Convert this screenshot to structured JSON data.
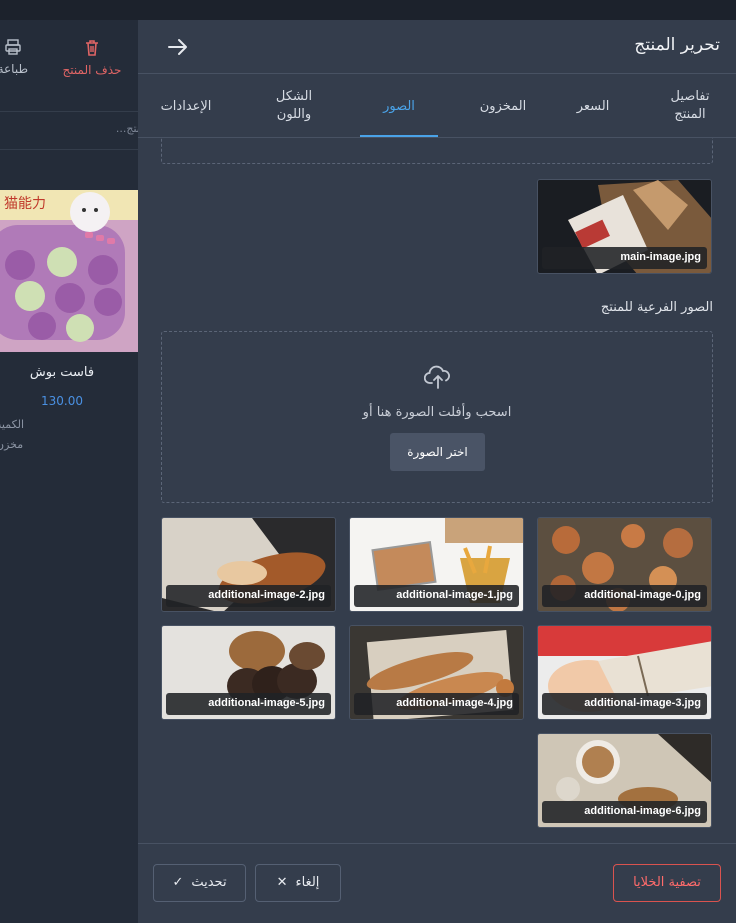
{
  "background_page": {
    "delete_label": "حذف المنتج",
    "print_label": "طباعة",
    "search_placeholder": "منتج...",
    "product_name": "فاست بوش",
    "product_price": "130.00",
    "meta_1": "الكمية",
    "meta_2": "مخزن",
    "card_text": "猫能力"
  },
  "drawer": {
    "title": "تحرير المنتج",
    "tabs": [
      {
        "label": "تفاصيل المنتج",
        "active": false
      },
      {
        "label": "السعر",
        "active": false
      },
      {
        "label": "المخزون",
        "active": false
      },
      {
        "label": "الصور",
        "active": true
      },
      {
        "label": "الشكل واللون",
        "active": false
      },
      {
        "label": "الإعدادات",
        "active": false
      }
    ],
    "main_image": {
      "filename": "main-image.jpg"
    },
    "sub_images_label": "الصور الفرعية للمنتج",
    "dropzone": {
      "text": "اسحب وأفلت الصورة هنا أو",
      "button_label": "اختر الصورة",
      "icon": "upload-cloud-icon"
    },
    "additional_images": [
      {
        "filename": "additional-image-0.jpg",
        "subject": "cookies"
      },
      {
        "filename": "additional-image-1.jpg",
        "subject": "fries-and-tray"
      },
      {
        "filename": "additional-image-2.jpg",
        "subject": "bread-on-newspaper"
      },
      {
        "filename": "additional-image-3.jpg",
        "subject": "wrapped-pastry-in-hand"
      },
      {
        "filename": "additional-image-4.jpg",
        "subject": "baguettes-with-twine"
      },
      {
        "filename": "additional-image-5.jpg",
        "subject": "chocolate-bread-slices"
      },
      {
        "filename": "additional-image-6.jpg",
        "subject": "bowl-and-pretzels"
      }
    ],
    "footer": {
      "clear_label": "تصفية الخلايا",
      "cancel_label": "إلغاء",
      "update_label": "تحديث"
    }
  },
  "colors": {
    "accent": "#4aa3e8",
    "danger": "#e06565",
    "drawer_bg": "#343d4c"
  }
}
